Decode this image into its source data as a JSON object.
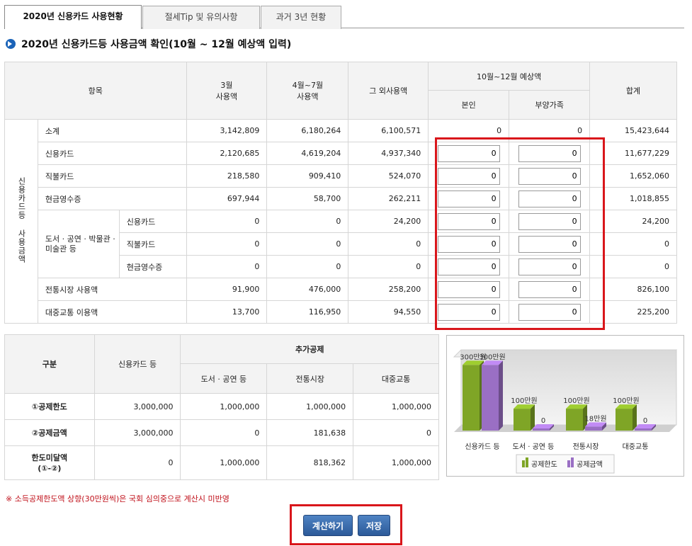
{
  "tabs": [
    {
      "label": "2020년 신용카드 사용현황"
    },
    {
      "label": "절세Tip 및 유의사항"
    },
    {
      "label": "과거 3년 현황"
    }
  ],
  "heading": "2020년 신용카드등 사용금액 확인(10월 ~ 12월 예상액 입력)",
  "usage_table": {
    "headers": {
      "item": "항목",
      "march": "3월\n사용액",
      "apr_jul": "4월~7월\n사용액",
      "other": "그 외사용액",
      "expected": "10월~12월 예상액",
      "self": "본인",
      "dependent": "부양가족",
      "total": "합계"
    },
    "group_label": "신용카드등 사용금액",
    "sub_group_label": "도서 · 공연 · 박물관 · 미술관 등",
    "rows": [
      {
        "label": "소계",
        "march": "3,142,809",
        "apr_jul": "6,180,264",
        "other": "6,100,571",
        "self": "0",
        "dependent": "0",
        "total": "15,423,644"
      },
      {
        "label": "신용카드",
        "march": "2,120,685",
        "apr_jul": "4,619,204",
        "other": "4,937,340",
        "self": "0",
        "dependent": "0",
        "total": "11,677,229"
      },
      {
        "label": "직불카드",
        "march": "218,580",
        "apr_jul": "909,410",
        "other": "524,070",
        "self": "0",
        "dependent": "0",
        "total": "1,652,060"
      },
      {
        "label": "현금영수증",
        "march": "697,944",
        "apr_jul": "58,700",
        "other": "262,211",
        "self": "0",
        "dependent": "0",
        "total": "1,018,855"
      },
      {
        "label": "신용카드",
        "march": "0",
        "apr_jul": "0",
        "other": "24,200",
        "self": "0",
        "dependent": "0",
        "total": "24,200"
      },
      {
        "label": "직불카드",
        "march": "0",
        "apr_jul": "0",
        "other": "0",
        "self": "0",
        "dependent": "0",
        "total": "0"
      },
      {
        "label": "현금영수증",
        "march": "0",
        "apr_jul": "0",
        "other": "0",
        "self": "0",
        "dependent": "0",
        "total": "0"
      },
      {
        "label": "전통시장 사용액",
        "march": "91,900",
        "apr_jul": "476,000",
        "other": "258,200",
        "self": "0",
        "dependent": "0",
        "total": "826,100"
      },
      {
        "label": "대중교통 이용액",
        "march": "13,700",
        "apr_jul": "116,950",
        "other": "94,550",
        "self": "0",
        "dependent": "0",
        "total": "225,200"
      }
    ]
  },
  "deduction_table": {
    "headers": {
      "category": "구분",
      "card": "신용카드 등",
      "additional": "추가공제",
      "books": "도서 · 공연 등",
      "market": "전통시장",
      "transit": "대중교통"
    },
    "rows": [
      {
        "label": "①공제한도",
        "card": "3,000,000",
        "books": "1,000,000",
        "market": "1,000,000",
        "transit": "1,000,000"
      },
      {
        "label": "②공제금액",
        "card": "3,000,000",
        "books": "0",
        "market": "181,638",
        "transit": "0"
      },
      {
        "label": "한도미달액\n(①-②)",
        "card": "0",
        "books": "1,000,000",
        "market": "818,362",
        "transit": "1,000,000"
      }
    ]
  },
  "chart_data": {
    "type": "bar",
    "categories": [
      "신용카드 등",
      "도서 · 공연 등",
      "전통시장",
      "대중교통"
    ],
    "series": [
      {
        "name": "공제한도",
        "values": [
          300,
          100,
          100,
          100
        ],
        "labels": [
          "300만원",
          "100만원",
          "100만원",
          "100만원"
        ],
        "color": "#7fa526"
      },
      {
        "name": "공제금액",
        "values": [
          300,
          0,
          18,
          0
        ],
        "labels": [
          "300만원",
          "0",
          "18만원",
          "0"
        ],
        "color": "#9a6fc4"
      }
    ],
    "ylim": [
      0,
      330
    ],
    "legend": "bottom"
  },
  "note": "※ 소득공제한도액 상향(30만원씩)은 국회 심의중으로 계산시 미반영",
  "buttons": {
    "calculate": "계산하기",
    "save": "저장"
  }
}
